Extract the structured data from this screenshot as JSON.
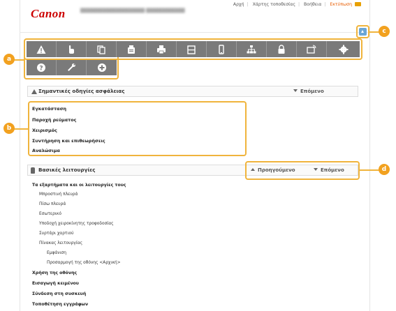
{
  "header": {
    "logo": "Canon",
    "links": [
      "Αρχή",
      "Χάρτης τοποθεσίας",
      "Βοήθεια",
      "Εκτύπωση"
    ],
    "colors": {
      "brand": "#cc0000",
      "print_link": "#e85c00"
    }
  },
  "icon_bar": {
    "row1": [
      "warning-icon",
      "hand-icon",
      "copy-icon",
      "fax-icon",
      "print-icon",
      "scan-icon",
      "mobile-icon",
      "network-icon",
      "security-icon",
      "remote-ui-icon",
      "settings-icon"
    ],
    "row2": [
      "question-icon",
      "wrench-icon",
      "plus-icon"
    ]
  },
  "callouts": [
    "a",
    "b",
    "c",
    "d"
  ],
  "safety": {
    "title": "Σημαντικές οδηγίες ασφάλειας",
    "next": "Επόμενο",
    "items": [
      "Εγκατάσταση",
      "Παροχή ρεύματος",
      "Χειρισμός",
      "Συντήρηση και επιθεωρήσεις",
      "Αναλώσιμα"
    ]
  },
  "basic": {
    "title": "Βασικές λειτουργίες",
    "prev": "Προηγούμενο",
    "next": "Επόμενο",
    "tree": {
      "group1": "Τα εξαρτήματα και οι λειτουργίες τους",
      "sub": [
        "Μπροστινή πλευρά",
        "Πίσω πλευρά",
        "Εσωτερικό",
        "Υποδοχή χειροκίνητης τροφοδοσίας",
        "Συρτάρι χαρτιού",
        "Πίνακας λειτουργίας"
      ],
      "subsub": [
        "Εμφάνιση",
        "Προσαρμογή της οθόνης <Αρχική>"
      ],
      "bold": [
        "Χρήση της οθόνης",
        "Εισαγωγή κειμένου",
        "Σύνδεση στη συσκευή",
        "Τοποθέτηση εγγράφων"
      ]
    }
  }
}
